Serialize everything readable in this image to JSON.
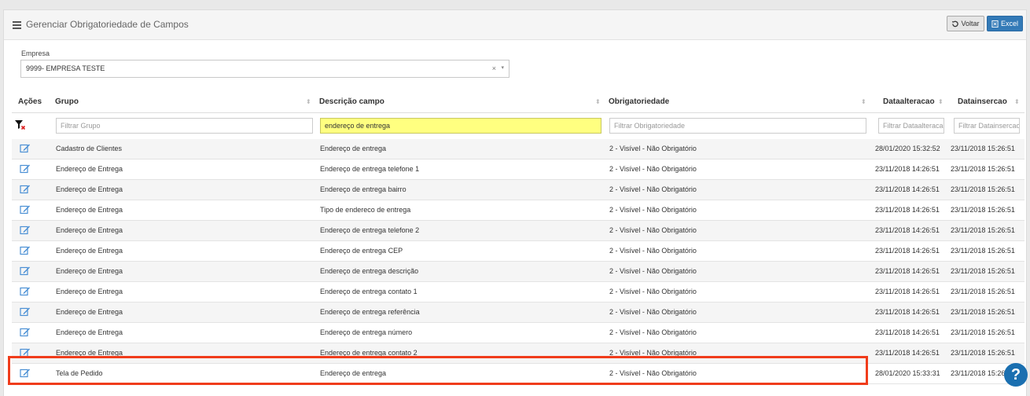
{
  "header": {
    "title": "Gerenciar Obrigatoriedade de Campos",
    "voltar_label": "Voltar",
    "excel_label": "Excel"
  },
  "empresa": {
    "label": "Empresa",
    "value": "9999- EMPRESA TESTE",
    "clear": "×",
    "arrow": "▾"
  },
  "table": {
    "headers": [
      "Ações",
      "Grupo",
      "Descrição campo",
      "Obrigatoriedade",
      "Dataalteracao",
      "Datainsercao"
    ],
    "filters": {
      "grupo_placeholder": "Filtrar Grupo",
      "descricao_value": "endereço de entrega",
      "obrigatoriedade_placeholder": "Filtrar Obrigatoriedade",
      "dataalteracao_placeholder": "Filtrar Dataalteracao",
      "datainsercao_placeholder": "Filtrar Datainsercao"
    },
    "rows": [
      {
        "grupo": "Cadastro de Clientes",
        "descricao": "Endereço de entrega",
        "obrig": "2 - Visível - Não Obrigatório",
        "alt": "28/01/2020 15:32:52",
        "ins": "23/11/2018 15:26:51"
      },
      {
        "grupo": "Endereço de Entrega",
        "descricao": "Endereço de entrega telefone 1",
        "obrig": "2 - Visível - Não Obrigatório",
        "alt": "23/11/2018 14:26:51",
        "ins": "23/11/2018 15:26:51"
      },
      {
        "grupo": "Endereço de Entrega",
        "descricao": "Endereço de entrega bairro",
        "obrig": "2 - Visível - Não Obrigatório",
        "alt": "23/11/2018 14:26:51",
        "ins": "23/11/2018 15:26:51"
      },
      {
        "grupo": "Endereço de Entrega",
        "descricao": "Tipo de endereco de entrega",
        "obrig": "2 - Visível - Não Obrigatório",
        "alt": "23/11/2018 14:26:51",
        "ins": "23/11/2018 15:26:51"
      },
      {
        "grupo": "Endereço de Entrega",
        "descricao": "Endereço de entrega telefone 2",
        "obrig": "2 - Visível - Não Obrigatório",
        "alt": "23/11/2018 14:26:51",
        "ins": "23/11/2018 15:26:51"
      },
      {
        "grupo": "Endereço de Entrega",
        "descricao": "Endereço de entrega CEP",
        "obrig": "2 - Visível - Não Obrigatório",
        "alt": "23/11/2018 14:26:51",
        "ins": "23/11/2018 15:26:51"
      },
      {
        "grupo": "Endereço de Entrega",
        "descricao": "Endereço de entrega descrição",
        "obrig": "2 - Visível - Não Obrigatório",
        "alt": "23/11/2018 14:26:51",
        "ins": "23/11/2018 15:26:51"
      },
      {
        "grupo": "Endereço de Entrega",
        "descricao": "Endereço de entrega contato 1",
        "obrig": "2 - Visível - Não Obrigatório",
        "alt": "23/11/2018 14:26:51",
        "ins": "23/11/2018 15:26:51"
      },
      {
        "grupo": "Endereço de Entrega",
        "descricao": "Endereço de entrega referência",
        "obrig": "2 - Visível - Não Obrigatório",
        "alt": "23/11/2018 14:26:51",
        "ins": "23/11/2018 15:26:51"
      },
      {
        "grupo": "Endereço de Entrega",
        "descricao": "Endereço de entrega número",
        "obrig": "2 - Visível - Não Obrigatório",
        "alt": "23/11/2018 14:26:51",
        "ins": "23/11/2018 15:26:51"
      },
      {
        "grupo": "Endereço de Entrega",
        "descricao": "Endereço de entrega contato 2",
        "obrig": "2 - Visível - Não Obrigatório",
        "alt": "23/11/2018 14:26:51",
        "ins": "23/11/2018 15:26:51"
      },
      {
        "grupo": "Tela de Pedido",
        "descricao": "Endereço de entrega",
        "obrig": "2 - Visível - Não Obrigatório",
        "alt": "28/01/2020 15:33:31",
        "ins": "23/11/2018 15:26:51"
      }
    ]
  },
  "help": {
    "label": "?"
  },
  "colors": {
    "highlight": "#f03c1b",
    "filter_active": "#ffff80",
    "primary": "#337ab7",
    "edit_icon": "#4a8fd4"
  }
}
